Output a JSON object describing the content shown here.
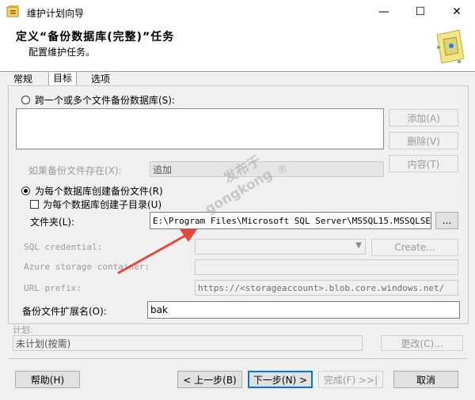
{
  "window": {
    "title": "维护计划向导",
    "controls": [
      "—",
      "☐",
      "✕"
    ]
  },
  "header": {
    "title": "定义“备份数据库(完整)”任务",
    "subtitle": "配置维护任务。"
  },
  "tabs": [
    {
      "label": "常规"
    },
    {
      "label": "目标"
    },
    {
      "label": "选项"
    }
  ],
  "target": {
    "radio_span_label": "跨一个或多个文件备份数据库(S):",
    "add_button": "添加(A)",
    "remove_button": "删除(V)",
    "contents_button": "内容(T)",
    "if_exists_label": "如果备份文件存在(X):",
    "if_exists_value": "追加",
    "radio_each_label": "为每个数据库创建备份文件(R)",
    "subdir_label": "为每个数据库创建子目录(U)",
    "folder_label": "文件夹(L):",
    "folder_value": "E:\\Program Files\\Microsoft SQL Server\\MSSQL15.MSSQLSE",
    "browse_button": "...",
    "sql_credential_label": "SQL credential:",
    "create_button": "Create...",
    "azure_container_label": "Azure storage container:",
    "url_prefix_label": "URL prefix:",
    "url_prefix_value": "https://<storageaccount>.blob.core.windows.net/",
    "extension_label": "备份文件扩展名(O):",
    "extension_value": "bak"
  },
  "schedule": {
    "label": "计划:",
    "value": "未计划(按需)",
    "change_button": "更改(C)..."
  },
  "footer": {
    "help": "帮助(H)",
    "back": "< 上一步(B)",
    "next": "下一步(N) >",
    "finish": "完成(F) >>|",
    "cancel": "取消"
  },
  "watermark": {
    "text1": "发布于",
    "text2": "gongkong",
    "reg": "®"
  },
  "colors": {
    "arrow": "#e8463a",
    "accent": "#0078d7"
  }
}
